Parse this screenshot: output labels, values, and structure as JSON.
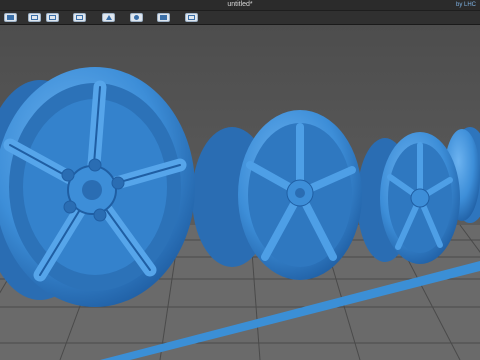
{
  "window": {
    "title": "untitled*",
    "corner_text": "by LHC"
  },
  "toolbar": {
    "buttons": [
      {
        "name": "select-icon"
      },
      {
        "name": "view-front-icon"
      },
      {
        "name": "view-side-icon"
      },
      {
        "name": "view-top-icon"
      },
      {
        "name": "perspective-icon"
      },
      {
        "name": "shading-icon"
      },
      {
        "name": "solid-view-icon"
      },
      {
        "name": "frame-view-icon"
      }
    ]
  },
  "viewport": {
    "background": "#5a5a5a",
    "floor_color": "#6e6e6e",
    "grid_color": "#3f3f3f",
    "axis_color": "#3b8fd6",
    "model_color": "#3d8ed8",
    "model_dark": "#1f5ea3",
    "model_light": "#7fc0f5"
  }
}
